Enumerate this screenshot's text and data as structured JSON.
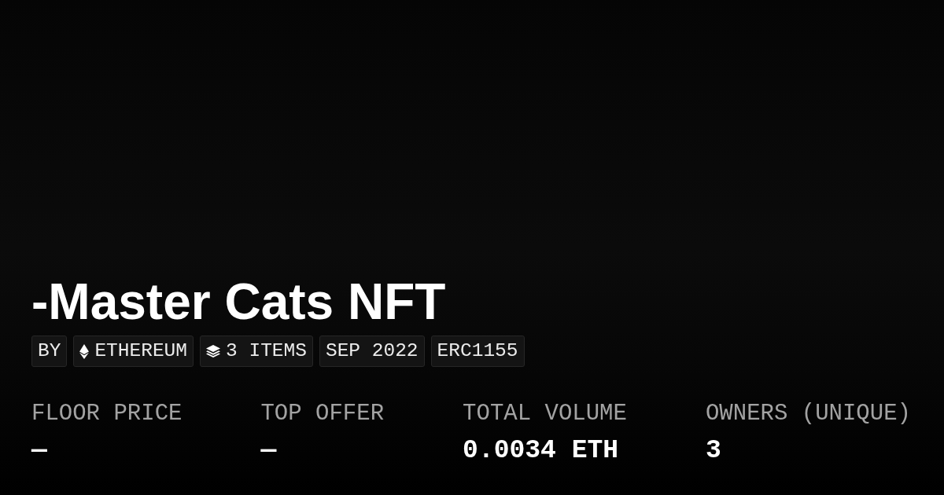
{
  "title": "-Master Cats NFT",
  "tags": [
    {
      "kind": "text",
      "label": "BY"
    },
    {
      "kind": "chain",
      "label": "ETHEREUM"
    },
    {
      "kind": "items",
      "label": "3 ITEMS"
    },
    {
      "kind": "text",
      "label": "SEP 2022"
    },
    {
      "kind": "text",
      "label": "ERC1155"
    }
  ],
  "stats": [
    {
      "label": "FLOOR PRICE",
      "value": "—"
    },
    {
      "label": "TOP OFFER",
      "value": "—"
    },
    {
      "label": "TOTAL VOLUME",
      "value": "0.0034 ETH"
    },
    {
      "label": "OWNERS (UNIQUE)",
      "value": "3"
    }
  ]
}
